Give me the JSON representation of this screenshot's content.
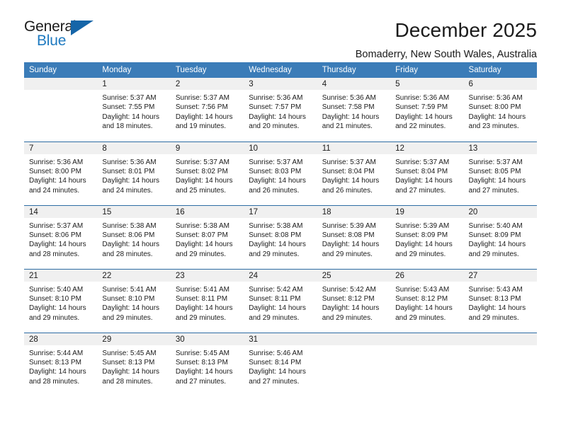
{
  "brand": {
    "name_top": "General",
    "name_bottom": "Blue",
    "triangle_color": "#1565a8",
    "blue_color": "#1f7ac0"
  },
  "header": {
    "title": "December 2025",
    "subtitle": "Bomaderry, New South Wales, Australia"
  },
  "theme": {
    "header_bg": "#3b7cb8",
    "row_separator": "#2e6da4",
    "daynum_bg": "#f0f0f0",
    "text": "#1b1b1b"
  },
  "weekday_headers": [
    "Sunday",
    "Monday",
    "Tuesday",
    "Wednesday",
    "Thursday",
    "Friday",
    "Saturday"
  ],
  "weeks": [
    [
      {
        "day": "",
        "sunrise": "",
        "sunset": "",
        "daylight_line1": "",
        "daylight_line2": ""
      },
      {
        "day": "1",
        "sunrise": "Sunrise: 5:37 AM",
        "sunset": "Sunset: 7:55 PM",
        "daylight_line1": "Daylight: 14 hours",
        "daylight_line2": "and 18 minutes."
      },
      {
        "day": "2",
        "sunrise": "Sunrise: 5:37 AM",
        "sunset": "Sunset: 7:56 PM",
        "daylight_line1": "Daylight: 14 hours",
        "daylight_line2": "and 19 minutes."
      },
      {
        "day": "3",
        "sunrise": "Sunrise: 5:36 AM",
        "sunset": "Sunset: 7:57 PM",
        "daylight_line1": "Daylight: 14 hours",
        "daylight_line2": "and 20 minutes."
      },
      {
        "day": "4",
        "sunrise": "Sunrise: 5:36 AM",
        "sunset": "Sunset: 7:58 PM",
        "daylight_line1": "Daylight: 14 hours",
        "daylight_line2": "and 21 minutes."
      },
      {
        "day": "5",
        "sunrise": "Sunrise: 5:36 AM",
        "sunset": "Sunset: 7:59 PM",
        "daylight_line1": "Daylight: 14 hours",
        "daylight_line2": "and 22 minutes."
      },
      {
        "day": "6",
        "sunrise": "Sunrise: 5:36 AM",
        "sunset": "Sunset: 8:00 PM",
        "daylight_line1": "Daylight: 14 hours",
        "daylight_line2": "and 23 minutes."
      }
    ],
    [
      {
        "day": "7",
        "sunrise": "Sunrise: 5:36 AM",
        "sunset": "Sunset: 8:00 PM",
        "daylight_line1": "Daylight: 14 hours",
        "daylight_line2": "and 24 minutes."
      },
      {
        "day": "8",
        "sunrise": "Sunrise: 5:36 AM",
        "sunset": "Sunset: 8:01 PM",
        "daylight_line1": "Daylight: 14 hours",
        "daylight_line2": "and 24 minutes."
      },
      {
        "day": "9",
        "sunrise": "Sunrise: 5:37 AM",
        "sunset": "Sunset: 8:02 PM",
        "daylight_line1": "Daylight: 14 hours",
        "daylight_line2": "and 25 minutes."
      },
      {
        "day": "10",
        "sunrise": "Sunrise: 5:37 AM",
        "sunset": "Sunset: 8:03 PM",
        "daylight_line1": "Daylight: 14 hours",
        "daylight_line2": "and 26 minutes."
      },
      {
        "day": "11",
        "sunrise": "Sunrise: 5:37 AM",
        "sunset": "Sunset: 8:04 PM",
        "daylight_line1": "Daylight: 14 hours",
        "daylight_line2": "and 26 minutes."
      },
      {
        "day": "12",
        "sunrise": "Sunrise: 5:37 AM",
        "sunset": "Sunset: 8:04 PM",
        "daylight_line1": "Daylight: 14 hours",
        "daylight_line2": "and 27 minutes."
      },
      {
        "day": "13",
        "sunrise": "Sunrise: 5:37 AM",
        "sunset": "Sunset: 8:05 PM",
        "daylight_line1": "Daylight: 14 hours",
        "daylight_line2": "and 27 minutes."
      }
    ],
    [
      {
        "day": "14",
        "sunrise": "Sunrise: 5:37 AM",
        "sunset": "Sunset: 8:06 PM",
        "daylight_line1": "Daylight: 14 hours",
        "daylight_line2": "and 28 minutes."
      },
      {
        "day": "15",
        "sunrise": "Sunrise: 5:38 AM",
        "sunset": "Sunset: 8:06 PM",
        "daylight_line1": "Daylight: 14 hours",
        "daylight_line2": "and 28 minutes."
      },
      {
        "day": "16",
        "sunrise": "Sunrise: 5:38 AM",
        "sunset": "Sunset: 8:07 PM",
        "daylight_line1": "Daylight: 14 hours",
        "daylight_line2": "and 29 minutes."
      },
      {
        "day": "17",
        "sunrise": "Sunrise: 5:38 AM",
        "sunset": "Sunset: 8:08 PM",
        "daylight_line1": "Daylight: 14 hours",
        "daylight_line2": "and 29 minutes."
      },
      {
        "day": "18",
        "sunrise": "Sunrise: 5:39 AM",
        "sunset": "Sunset: 8:08 PM",
        "daylight_line1": "Daylight: 14 hours",
        "daylight_line2": "and 29 minutes."
      },
      {
        "day": "19",
        "sunrise": "Sunrise: 5:39 AM",
        "sunset": "Sunset: 8:09 PM",
        "daylight_line1": "Daylight: 14 hours",
        "daylight_line2": "and 29 minutes."
      },
      {
        "day": "20",
        "sunrise": "Sunrise: 5:40 AM",
        "sunset": "Sunset: 8:09 PM",
        "daylight_line1": "Daylight: 14 hours",
        "daylight_line2": "and 29 minutes."
      }
    ],
    [
      {
        "day": "21",
        "sunrise": "Sunrise: 5:40 AM",
        "sunset": "Sunset: 8:10 PM",
        "daylight_line1": "Daylight: 14 hours",
        "daylight_line2": "and 29 minutes."
      },
      {
        "day": "22",
        "sunrise": "Sunrise: 5:41 AM",
        "sunset": "Sunset: 8:10 PM",
        "daylight_line1": "Daylight: 14 hours",
        "daylight_line2": "and 29 minutes."
      },
      {
        "day": "23",
        "sunrise": "Sunrise: 5:41 AM",
        "sunset": "Sunset: 8:11 PM",
        "daylight_line1": "Daylight: 14 hours",
        "daylight_line2": "and 29 minutes."
      },
      {
        "day": "24",
        "sunrise": "Sunrise: 5:42 AM",
        "sunset": "Sunset: 8:11 PM",
        "daylight_line1": "Daylight: 14 hours",
        "daylight_line2": "and 29 minutes."
      },
      {
        "day": "25",
        "sunrise": "Sunrise: 5:42 AM",
        "sunset": "Sunset: 8:12 PM",
        "daylight_line1": "Daylight: 14 hours",
        "daylight_line2": "and 29 minutes."
      },
      {
        "day": "26",
        "sunrise": "Sunrise: 5:43 AM",
        "sunset": "Sunset: 8:12 PM",
        "daylight_line1": "Daylight: 14 hours",
        "daylight_line2": "and 29 minutes."
      },
      {
        "day": "27",
        "sunrise": "Sunrise: 5:43 AM",
        "sunset": "Sunset: 8:13 PM",
        "daylight_line1": "Daylight: 14 hours",
        "daylight_line2": "and 29 minutes."
      }
    ],
    [
      {
        "day": "28",
        "sunrise": "Sunrise: 5:44 AM",
        "sunset": "Sunset: 8:13 PM",
        "daylight_line1": "Daylight: 14 hours",
        "daylight_line2": "and 28 minutes."
      },
      {
        "day": "29",
        "sunrise": "Sunrise: 5:45 AM",
        "sunset": "Sunset: 8:13 PM",
        "daylight_line1": "Daylight: 14 hours",
        "daylight_line2": "and 28 minutes."
      },
      {
        "day": "30",
        "sunrise": "Sunrise: 5:45 AM",
        "sunset": "Sunset: 8:13 PM",
        "daylight_line1": "Daylight: 14 hours",
        "daylight_line2": "and 27 minutes."
      },
      {
        "day": "31",
        "sunrise": "Sunrise: 5:46 AM",
        "sunset": "Sunset: 8:14 PM",
        "daylight_line1": "Daylight: 14 hours",
        "daylight_line2": "and 27 minutes."
      },
      {
        "day": "",
        "sunrise": "",
        "sunset": "",
        "daylight_line1": "",
        "daylight_line2": ""
      },
      {
        "day": "",
        "sunrise": "",
        "sunset": "",
        "daylight_line1": "",
        "daylight_line2": ""
      },
      {
        "day": "",
        "sunrise": "",
        "sunset": "",
        "daylight_line1": "",
        "daylight_line2": ""
      }
    ]
  ]
}
